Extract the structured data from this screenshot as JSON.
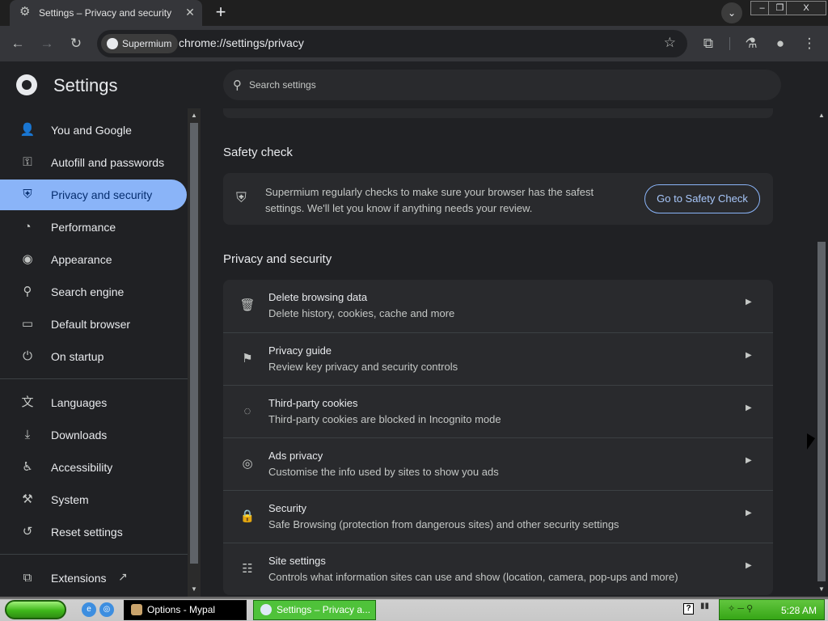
{
  "window": {
    "tab_title": "Settings – Privacy and security",
    "tab_icon": "gear-icon",
    "minimize": "–",
    "restore": "❐",
    "close": "X",
    "tab_close": "✕",
    "new_tab": "+",
    "tab_search": "⌄"
  },
  "toolbar": {
    "site_chip": "Supermium",
    "url": "chrome://settings/privacy"
  },
  "header": {
    "title": "Settings",
    "search_placeholder": "Search settings"
  },
  "sidebar": {
    "items": [
      {
        "label": "You and Google",
        "icon": "person-icon",
        "glyph": "👤"
      },
      {
        "label": "Autofill and passwords",
        "icon": "key-icon",
        "glyph": "⚿"
      },
      {
        "label": "Privacy and security",
        "icon": "shield-icon",
        "glyph": "⛨",
        "active": true
      },
      {
        "label": "Performance",
        "icon": "speedometer-icon",
        "glyph": "◔"
      },
      {
        "label": "Appearance",
        "icon": "palette-icon",
        "glyph": "◉"
      },
      {
        "label": "Search engine",
        "icon": "search-icon",
        "glyph": "⚲"
      },
      {
        "label": "Default browser",
        "icon": "browser-window-icon",
        "glyph": "▭"
      },
      {
        "label": "On startup",
        "icon": "power-icon",
        "glyph": "⏻"
      },
      {
        "label": "Languages",
        "icon": "translate-icon",
        "glyph": "文"
      },
      {
        "label": "Downloads",
        "icon": "download-icon",
        "glyph": "⤓"
      },
      {
        "label": "Accessibility",
        "icon": "accessibility-icon",
        "glyph": "♿"
      },
      {
        "label": "System",
        "icon": "wrench-icon",
        "glyph": "⚒"
      },
      {
        "label": "Reset settings",
        "icon": "reset-icon",
        "glyph": "↺"
      },
      {
        "label": "Extensions",
        "icon": "puzzle-icon",
        "glyph": "⧉"
      }
    ],
    "extensions_open_icon": "↗"
  },
  "main": {
    "safety_check": {
      "title": "Safety check",
      "text": "Supermium regularly checks to make sure your browser has the safest settings. We'll let you know if anything needs your review.",
      "button": "Go to Safety Check"
    },
    "privacy": {
      "title": "Privacy and security",
      "rows": [
        {
          "title": "Delete browsing data",
          "subtitle": "Delete history, cookies, cache and more",
          "icon": "trash-icon",
          "glyph": "🗑"
        },
        {
          "title": "Privacy guide",
          "subtitle": "Review key privacy and security controls",
          "icon": "signpost-icon",
          "glyph": "⚑"
        },
        {
          "title": "Third-party cookies",
          "subtitle": "Third-party cookies are blocked in Incognito mode",
          "icon": "cookie-icon",
          "glyph": "◌"
        },
        {
          "title": "Ads privacy",
          "subtitle": "Customise the info used by sites to show you ads",
          "icon": "ads-privacy-icon",
          "glyph": "◎"
        },
        {
          "title": "Security",
          "subtitle": "Safe Browsing (protection from dangerous sites) and other security settings",
          "icon": "lock-icon",
          "glyph": "🔒"
        },
        {
          "title": "Site settings",
          "subtitle": "Controls what information sites can use and show (location, camera, pop-ups and more)",
          "icon": "sliders-icon",
          "glyph": "☷"
        }
      ]
    }
  },
  "taskbar": {
    "tasks": [
      {
        "label": "Options - Mypal"
      },
      {
        "label": "Settings – Privacy a..."
      }
    ],
    "help": "?",
    "clock": "5:28 AM"
  }
}
